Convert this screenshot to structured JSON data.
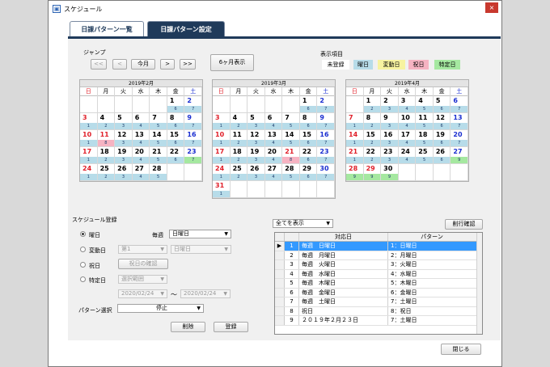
{
  "window": {
    "title": "スケジュール",
    "close_glyph": "×"
  },
  "tabs": [
    {
      "label": "日課パターン一覧"
    },
    {
      "label": "日課パターン設定"
    }
  ],
  "jump": {
    "label": "ジャンプ",
    "first": "<<",
    "prev": "<",
    "this_month": "今月",
    "next": ">",
    "last": ">>",
    "six_month": "6ヶ月表示"
  },
  "legend": {
    "label": "表示項目",
    "items": [
      {
        "label": "未登録",
        "color": "#ffffff"
      },
      {
        "label": "曜日",
        "color": "#b7dce9"
      },
      {
        "label": "変動日",
        "color": "#f7f3a0"
      },
      {
        "label": "祝日",
        "color": "#f6b3c2"
      },
      {
        "label": "特定日",
        "color": "#a5e8a0"
      }
    ]
  },
  "weekdays": [
    "日",
    "月",
    "火",
    "水",
    "木",
    "金",
    "土"
  ],
  "calendars": [
    {
      "title": "2019年2月",
      "start": 5,
      "days": 28,
      "pats": {
        "3": "1",
        "4": "2",
        "5": "3",
        "6": "4",
        "7": "5",
        "8": "6",
        "9": "7"
      },
      "special": {
        "11": {
          "pat": "8",
          "type": "holiday"
        },
        "23": {
          "pat": "7",
          "type": "specific"
        }
      }
    },
    {
      "title": "2019年3月",
      "start": 5,
      "days": 31,
      "pats": {
        "3": "1",
        "4": "2",
        "5": "3",
        "6": "4",
        "7": "5",
        "8": "6",
        "9": "7"
      },
      "special": {
        "21": {
          "pat": "8",
          "type": "holiday"
        }
      }
    },
    {
      "title": "2019年4月",
      "start": 1,
      "days": 30,
      "pats": {
        "3": "1",
        "4": "2",
        "5": "3",
        "6": "4",
        "7": "5",
        "8": "6",
        "9": "7"
      },
      "special": {
        "27": {
          "pat": "9",
          "type": "specific"
        },
        "28": {
          "pat": "9",
          "type": "specific"
        },
        "29": {
          "pat": "9",
          "type": "specific"
        },
        "30": {
          "pat": "9",
          "type": "specific"
        }
      },
      "hol": {
        "29": true
      }
    }
  ],
  "schedule": {
    "label": "スケジュール登録",
    "weekday_radio": "曜日",
    "every_week": "毎週",
    "weekday_select": "日曜日",
    "variable_radio": "変動日",
    "variable_select1": "第1",
    "variable_select2": "日曜日",
    "holiday_radio": "祝日",
    "holiday_confirm": "祝日の確認",
    "specific_radio": "特定日",
    "period_select": "選択範囲",
    "date_from": "2020/02/24",
    "tilde": "～",
    "date_to": "2020/02/24",
    "pattern_label": "パターン選択",
    "pattern_select": "停止",
    "delete_btn": "削除",
    "register_btn": "登録"
  },
  "list": {
    "filter": "全てを表示",
    "delete_confirm": "削行確認",
    "col_target": "対応日",
    "col_pattern": "パターン",
    "rows": [
      {
        "no": "1",
        "target": "毎週　日曜日",
        "pattern": "1：日曜日"
      },
      {
        "no": "2",
        "target": "毎週　月曜日",
        "pattern": "2：月曜日"
      },
      {
        "no": "3",
        "target": "毎週　火曜日",
        "pattern": "3：火曜日"
      },
      {
        "no": "4",
        "target": "毎週　水曜日",
        "pattern": "4：水曜日"
      },
      {
        "no": "5",
        "target": "毎週　木曜日",
        "pattern": "5：木曜日"
      },
      {
        "no": "6",
        "target": "毎週　金曜日",
        "pattern": "6：金曜日"
      },
      {
        "no": "7",
        "target": "毎週　土曜日",
        "pattern": "7：土曜日"
      },
      {
        "no": "8",
        "target": "祝日",
        "pattern": "8：祝日"
      },
      {
        "no": "9",
        "target": "２０１９年２月２３日",
        "pattern": "7：土曜日"
      }
    ]
  },
  "close_btn": "閉じる"
}
